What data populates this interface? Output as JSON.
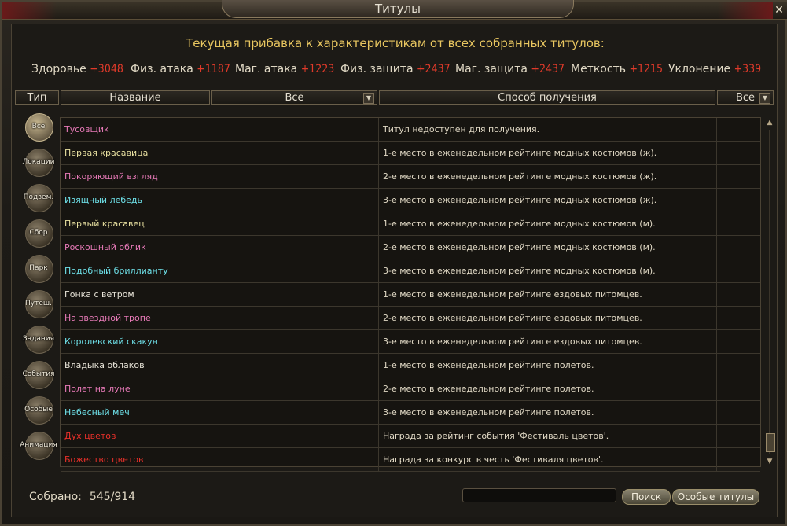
{
  "window": {
    "title": "Титулы"
  },
  "bonus": {
    "header": "Текущая прибавка к характеристикам от всех собранных титулов:",
    "stats": [
      {
        "label": "Здоровье",
        "value": "+3048"
      },
      {
        "label": "Физ. атака",
        "value": "+1187"
      },
      {
        "label": "Маг. атака",
        "value": "+1223"
      },
      {
        "label": "Физ. защита",
        "value": "+2437"
      },
      {
        "label": "Маг. защита",
        "value": "+2437"
      },
      {
        "label": "Меткость",
        "value": "+1215"
      },
      {
        "label": "Уклонение",
        "value": "+339"
      }
    ]
  },
  "columns": {
    "type": "Тип",
    "name": "Название",
    "filter": "Все",
    "source": "Способ получения",
    "filter2": "Все"
  },
  "categories": [
    {
      "label": "Все",
      "active": true
    },
    {
      "label": "Локации"
    },
    {
      "label": "Подзем."
    },
    {
      "label": "Сбор"
    },
    {
      "label": "Парк"
    },
    {
      "label": "Путеш."
    },
    {
      "label": "Задания"
    },
    {
      "label": "События"
    },
    {
      "label": "Особые"
    },
    {
      "label": "Анимация"
    }
  ],
  "colors": {
    "pink": "#e87ab8",
    "yellow": "#e8e0a0",
    "cyan": "#6ee0e8",
    "white": "#e8e4d8",
    "red": "#e8302a"
  },
  "rows": [
    {
      "name": "Тусовщик",
      "color": "#e87ab8",
      "source": "Титул недоступен для получения."
    },
    {
      "name": "Первая красавица",
      "color": "#e8e0a0",
      "source": "1-е место в еженедельном рейтинге модных костюмов (ж)."
    },
    {
      "name": "Покоряющий взгляд",
      "color": "#e87ab8",
      "source": "2-е место в еженедельном рейтинге модных костюмов (ж)."
    },
    {
      "name": "Изящный лебедь",
      "color": "#6ee0e8",
      "source": "3-е место в еженедельном рейтинге модных костюмов (ж)."
    },
    {
      "name": "Первый красавец",
      "color": "#e8e0a0",
      "source": "1-е место в еженедельном рейтинге модных костюмов (м)."
    },
    {
      "name": "Роскошный облик",
      "color": "#e87ab8",
      "source": "2-е место в еженедельном рейтинге модных костюмов (м)."
    },
    {
      "name": "Подобный бриллианту",
      "color": "#6ee0e8",
      "source": "3-е место в еженедельном рейтинге модных костюмов (м)."
    },
    {
      "name": "Гонка с ветром",
      "color": "#e8e4d8",
      "source": "1-е место в еженедельном рейтинге ездовых питомцев."
    },
    {
      "name": "На звездной тропе",
      "color": "#e87ab8",
      "source": "2-е место в еженедельном рейтинге ездовых питомцев."
    },
    {
      "name": "Королевский скакун",
      "color": "#6ee0e8",
      "source": "3-е место в еженедельном рейтинге ездовых питомцев."
    },
    {
      "name": "Владыка облаков",
      "color": "#e8e4d8",
      "source": "1-е место в еженедельном рейтинге полетов."
    },
    {
      "name": "Полет на луне",
      "color": "#e87ab8",
      "source": "2-е место в еженедельном рейтинге полетов."
    },
    {
      "name": "Небесный меч",
      "color": "#6ee0e8",
      "source": "3-е место в еженедельном рейтинге полетов."
    },
    {
      "name": "Дух цветов",
      "color": "#e8302a",
      "source": "Награда за рейтинг события 'Фестиваль цветов'."
    },
    {
      "name": "Божество цветов",
      "color": "#e8302a",
      "source": "Награда за конкурс в честь 'Фестиваля цветов'."
    }
  ],
  "footer": {
    "collected_label": "Собрано:",
    "collected_value": "545/914",
    "search_value": "",
    "search_button": "Поиск",
    "special_button": "Особые титулы"
  },
  "icons": {
    "close": "close-icon",
    "dropdown": "chevron-down-icon",
    "scroll_up": "arrow-up-icon",
    "scroll_down": "arrow-down-icon"
  }
}
